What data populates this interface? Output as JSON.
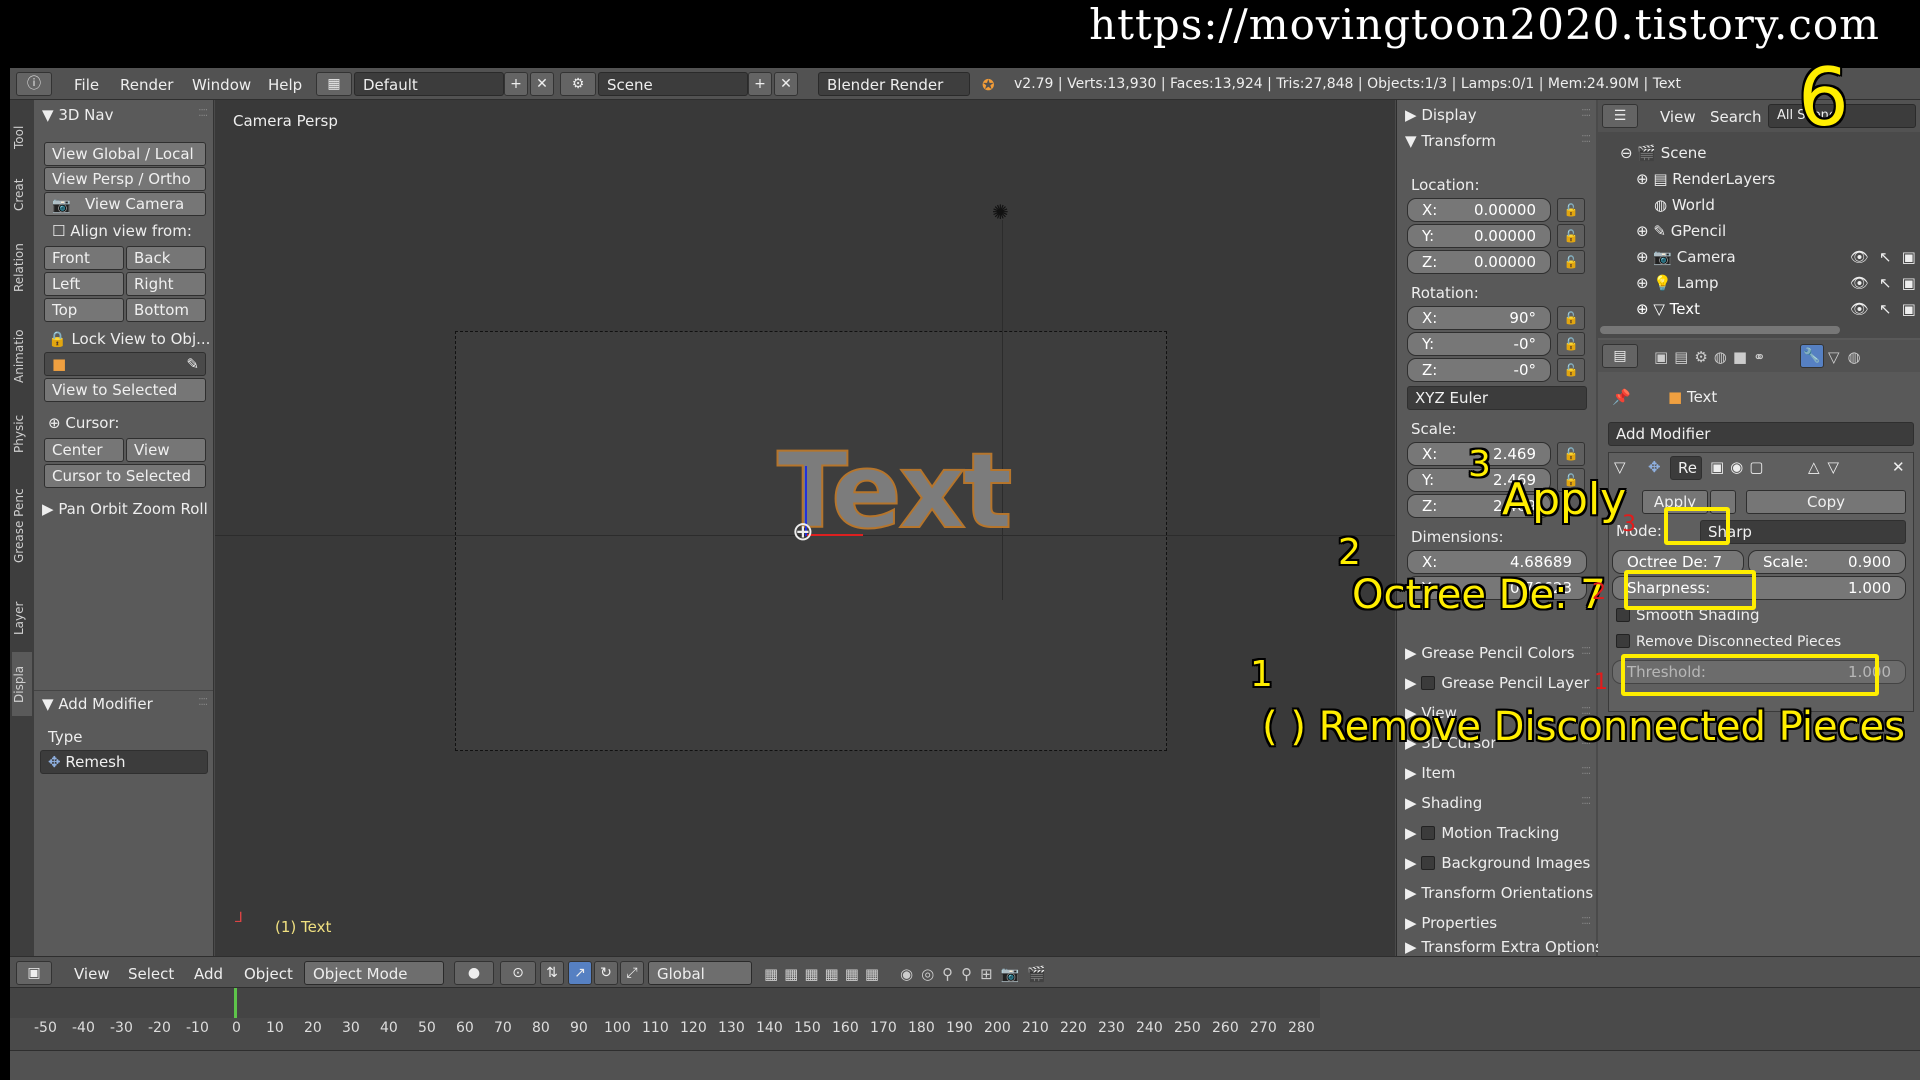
{
  "banner_url": "https://movingtoon2020.tistory.com",
  "menu": {
    "file": "File",
    "render": "Render",
    "window": "Window",
    "help": "Help",
    "layout": "Default",
    "scene": "Scene",
    "engine": "Blender Render",
    "stats": "v2.79 | Verts:13,930 | Faces:13,924 | Tris:27,848 | Objects:1/3 | Lamps:0/1 | Mem:24.90M | Text"
  },
  "side_tabs": [
    "Tool",
    "Creat",
    "Relation",
    "Animatio",
    "Physic",
    "Grease Penc",
    "Layer",
    "Displa"
  ],
  "nav": {
    "title": "3D Nav",
    "view_global": "View Global / Local",
    "view_persp": "View Persp / Ortho",
    "view_camera": "View Camera",
    "align": "Align view from:",
    "front": "Front",
    "back": "Back",
    "left": "Left",
    "right": "Right",
    "top": "Top",
    "bottom": "Bottom",
    "lock": "Lock View to Obj...",
    "view_selected": "View to Selected",
    "cursor": "Cursor:",
    "center": "Center",
    "view": "View",
    "cursor_selected": "Cursor to Selected",
    "pan": "Pan Orbit Zoom Roll"
  },
  "op_panel": {
    "title": "Add Modifier",
    "type_label": "Type",
    "type_value": "Remesh"
  },
  "viewport": {
    "label": "Camera Persp",
    "object_text": "Text",
    "footer_label": "(1) Text"
  },
  "npanel": {
    "display": "Display",
    "transform": "Transform",
    "location": "Location:",
    "loc": [
      {
        "axis": "X:",
        "value": "0.00000"
      },
      {
        "axis": "Y:",
        "value": "0.00000"
      },
      {
        "axis": "Z:",
        "value": "0.00000"
      }
    ],
    "rotation": "Rotation:",
    "rot": [
      {
        "axis": "X:",
        "value": "90°"
      },
      {
        "axis": "Y:",
        "value": "-0°"
      },
      {
        "axis": "Z:",
        "value": "-0°"
      }
    ],
    "euler": "XYZ Euler",
    "scale": "Scale:",
    "scl": [
      {
        "axis": "X:",
        "value": "2.469"
      },
      {
        "axis": "Y:",
        "value": "2.469"
      },
      {
        "axis": "Z:",
        "value": "2.469"
      }
    ],
    "dimensions": "Dimensions:",
    "dim": [
      {
        "axis": "X:",
        "value": "4.68689"
      },
      {
        "axis": "Y:",
        "value": "0.70623"
      }
    ],
    "sections": [
      "Grease Pencil Colors",
      "Grease Pencil Layer",
      "View",
      "3D Cursor",
      "Item",
      "Shading",
      "Motion Tracking",
      "Background Images",
      "Transform Orientations",
      "Properties",
      "Transform Extra Options"
    ]
  },
  "outliner": {
    "view": "View",
    "search": "Search",
    "all_scenes": "All Scenes",
    "items": [
      "Scene",
      "RenderLayers",
      "World",
      "GPencil",
      "Camera",
      "Lamp",
      "Text"
    ]
  },
  "props": {
    "object_name": "Text",
    "add_modifier": "Add Modifier",
    "mod_name": "Re",
    "apply": "Apply",
    "copy": "Copy",
    "mode_label": "Mode:",
    "mode_value": "Sharp",
    "octree": "Octree De: 7",
    "scale": "Scale:",
    "scale_value": "0.900",
    "sharpness": "Sharpness:",
    "sharpness_value": "1.000",
    "smooth": "Smooth Shading",
    "remove": "Remove Disconnected Pieces",
    "threshold": "Threshold:",
    "threshold_value": "1.000"
  },
  "bottom": {
    "view": "View",
    "select": "Select",
    "add": "Add",
    "object": "Object",
    "mode": "Object Mode",
    "orientation": "Global"
  },
  "ruler": [
    "-50",
    "-40",
    "-30",
    "-20",
    "-10",
    "0",
    "10",
    "20",
    "30",
    "40",
    "50",
    "60",
    "70",
    "80",
    "90",
    "100",
    "110",
    "120",
    "130",
    "140",
    "150",
    "160",
    "170",
    "180",
    "190",
    "200",
    "210",
    "220",
    "230",
    "240",
    "250",
    "260",
    "270",
    "280"
  ],
  "annotations": {
    "six": "6",
    "n3": "3",
    "apply": "Apply",
    "n2": "2",
    "octree": "Octree De: 7",
    "n1": "1",
    "remove": "(   ) Remove Disconnected Pieces",
    "red1": "1",
    "red2": "2",
    "red3": "3"
  },
  "colors": {
    "highlight": "#ffee00",
    "red_numbers": "#e21b1b",
    "text_object": "#808080"
  }
}
